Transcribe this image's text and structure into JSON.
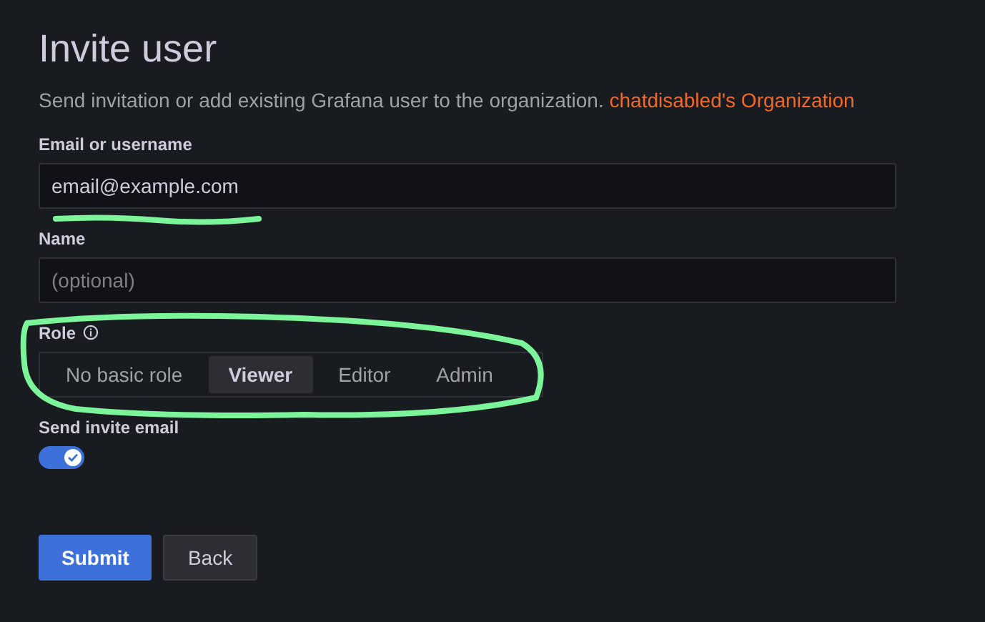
{
  "title": "Invite user",
  "subtitle": {
    "text": "Send invitation or add existing Grafana user to the organization.",
    "org_link": "chatdisabled's Organization"
  },
  "fields": [
    {
      "label": "Email or username",
      "value": "email@example.com"
    },
    {
      "label": "Name",
      "placeholder": "(optional)"
    }
  ],
  "role": {
    "label": "Role",
    "options": [
      {
        "label": "No basic role",
        "selected": false
      },
      {
        "label": "Viewer",
        "selected": true
      },
      {
        "label": "Editor",
        "selected": false
      },
      {
        "label": "Admin",
        "selected": false
      }
    ]
  },
  "send_invite": {
    "label": "Send invite email",
    "on": true
  },
  "buttons": [
    {
      "label": "Submit",
      "kind": "primary"
    },
    {
      "label": "Back",
      "kind": "secondary"
    }
  ]
}
